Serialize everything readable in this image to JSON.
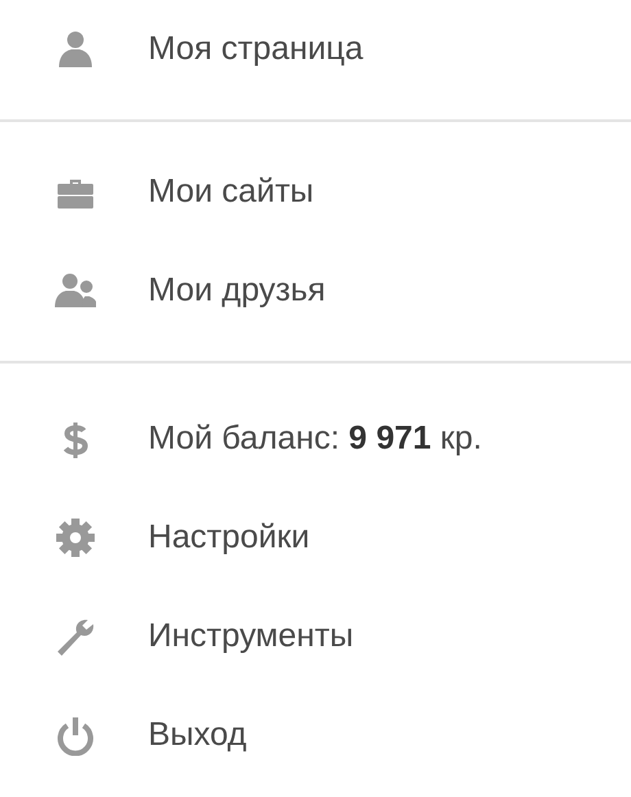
{
  "menu": {
    "sections": [
      {
        "items": [
          {
            "kind": "person",
            "label": "Моя страница"
          }
        ]
      },
      {
        "items": [
          {
            "kind": "briefcase",
            "label": "Мои сайты"
          },
          {
            "kind": "people",
            "label": "Мои друзья"
          }
        ]
      },
      {
        "items": [
          {
            "kind": "dollar",
            "label": "Мой баланс: **9 971** кр."
          },
          {
            "kind": "gear",
            "label": "Настройки"
          },
          {
            "kind": "wrench",
            "label": "Инструменты"
          },
          {
            "kind": "power",
            "label": "Выход"
          }
        ]
      }
    ]
  }
}
